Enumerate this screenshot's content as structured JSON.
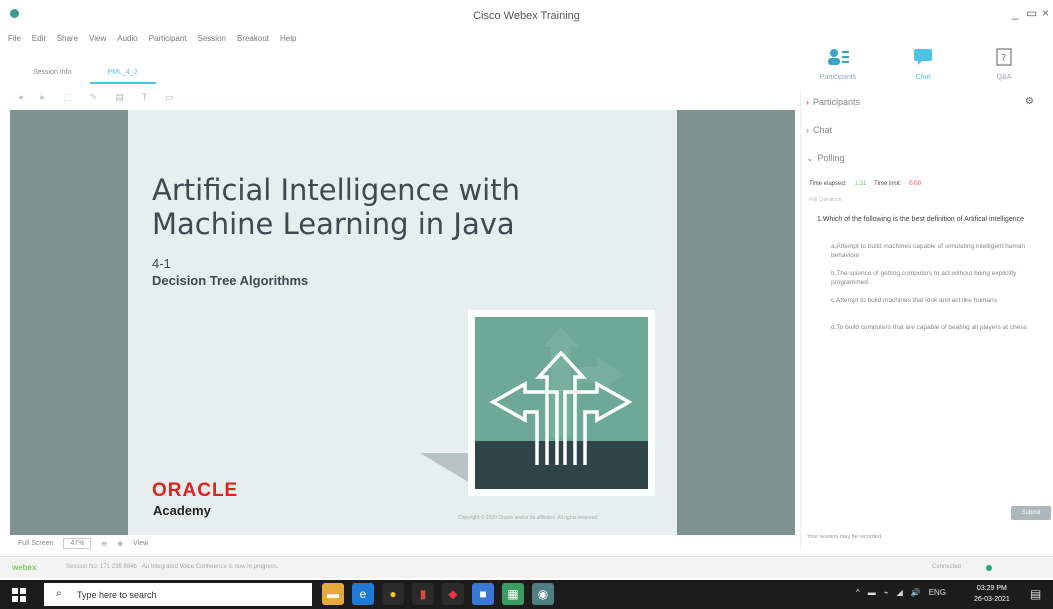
{
  "window": {
    "title": "Cisco Webex Training",
    "controls": [
      "_",
      "▭",
      "×"
    ]
  },
  "menu": [
    "File",
    "Edit",
    "Share",
    "View",
    "Audio",
    "Participant",
    "Session",
    "Breakout",
    "Help"
  ],
  "tabs": [
    {
      "label": "Session Info",
      "active": false
    },
    {
      "label": "PML_4_2",
      "active": true
    }
  ],
  "toolbar_icons": [
    "◂",
    "▸",
    "⬚",
    "✎",
    "▤",
    "T",
    "▭"
  ],
  "panel_buttons": [
    {
      "label": "Participants",
      "icon": "participants-icon"
    },
    {
      "label": "Chat",
      "icon": "chat-icon"
    },
    {
      "label": "Q&A",
      "icon": "qa-icon"
    }
  ],
  "slide": {
    "title_line1": "Artificial Intelligence with",
    "title_line2": "Machine Learning in Java",
    "number": "4-1",
    "subtitle": "Decision Tree Algorithms",
    "brand": "ORACLE",
    "brand_sub": "Academy",
    "footer": "Copyright © 2020 Oracle and/or its affiliates. All rights reserved."
  },
  "zoom": {
    "full_screen": "Full Screen",
    "value": "47%",
    "view": "View"
  },
  "status": {
    "logo": "webex",
    "session": "Session No: 171 236 884b",
    "note": "An Integrated Voice Conference is now in progress.",
    "connection": "Connected"
  },
  "right_panel": {
    "participants": "Participants",
    "chat": "Chat",
    "polling": "Polling",
    "time_elapsed_label": "Time elapsed:",
    "time_elapsed": "1:31",
    "time_left_label": "Time limit:",
    "time_left": "0:00",
    "poll_questions_label": "Poll Questions:",
    "question": "1.Which of the following is the best definition of Artifical intelligence",
    "options": [
      "a.Attempt to build machines capable of simulating intelligent human behaviour",
      "b.The science of getting computers to act without being explicitly programmed",
      "c.Attempt to build machines that look and act like humans",
      "d.To build computers that are capable of beating all players at chess"
    ],
    "submit": "Submit",
    "rec_note": "Your session may be recorded."
  },
  "taskbar": {
    "search_placeholder": "Type here to search",
    "tray": [
      "^",
      "▬",
      "⌁",
      "◢",
      "🔊",
      "ENG"
    ],
    "time": "03:29 PM",
    "date": "26-03-2021"
  },
  "colors": {
    "accent": "#4fc3e6",
    "stage": "#7f9292",
    "slide_bg": "#e6efed",
    "oracle_red": "#dd2222",
    "teal": "#6ea896"
  }
}
